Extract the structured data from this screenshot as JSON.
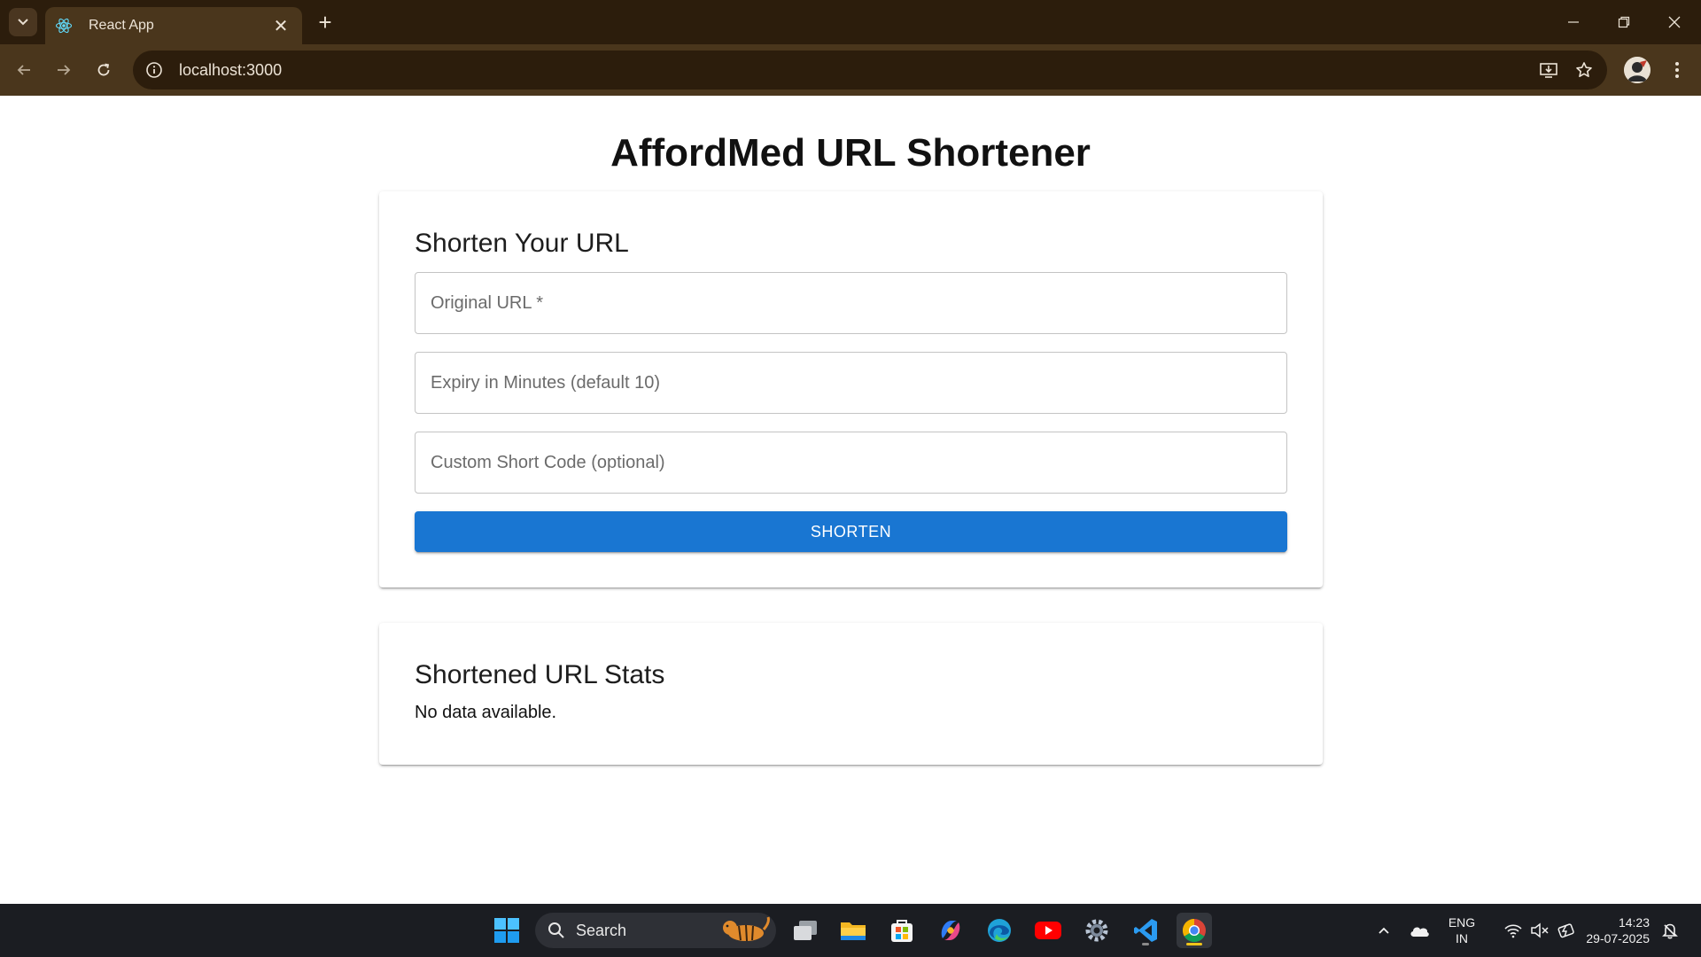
{
  "browser": {
    "tab_title": "React App",
    "url": "localhost:3000"
  },
  "page": {
    "title": "AffordMed URL Shortener",
    "form": {
      "heading": "Shorten Your URL",
      "original_url_placeholder": "Original URL *",
      "expiry_placeholder": "Expiry in Minutes (default 10)",
      "custom_code_placeholder": "Custom Short Code (optional)",
      "submit_label": "SHORTEN"
    },
    "stats": {
      "heading": "Shortened URL Stats",
      "empty_message": "No data available."
    }
  },
  "taskbar": {
    "search_label": "Search",
    "language_line1": "ENG",
    "language_line2": "IN",
    "time": "14:23",
    "date": "29-07-2025"
  },
  "colors": {
    "primary": "#1976d2",
    "chrome_dark": "#2c1d0c",
    "chrome_toolbar": "#4a361c",
    "taskbar": "#1b1d22"
  }
}
